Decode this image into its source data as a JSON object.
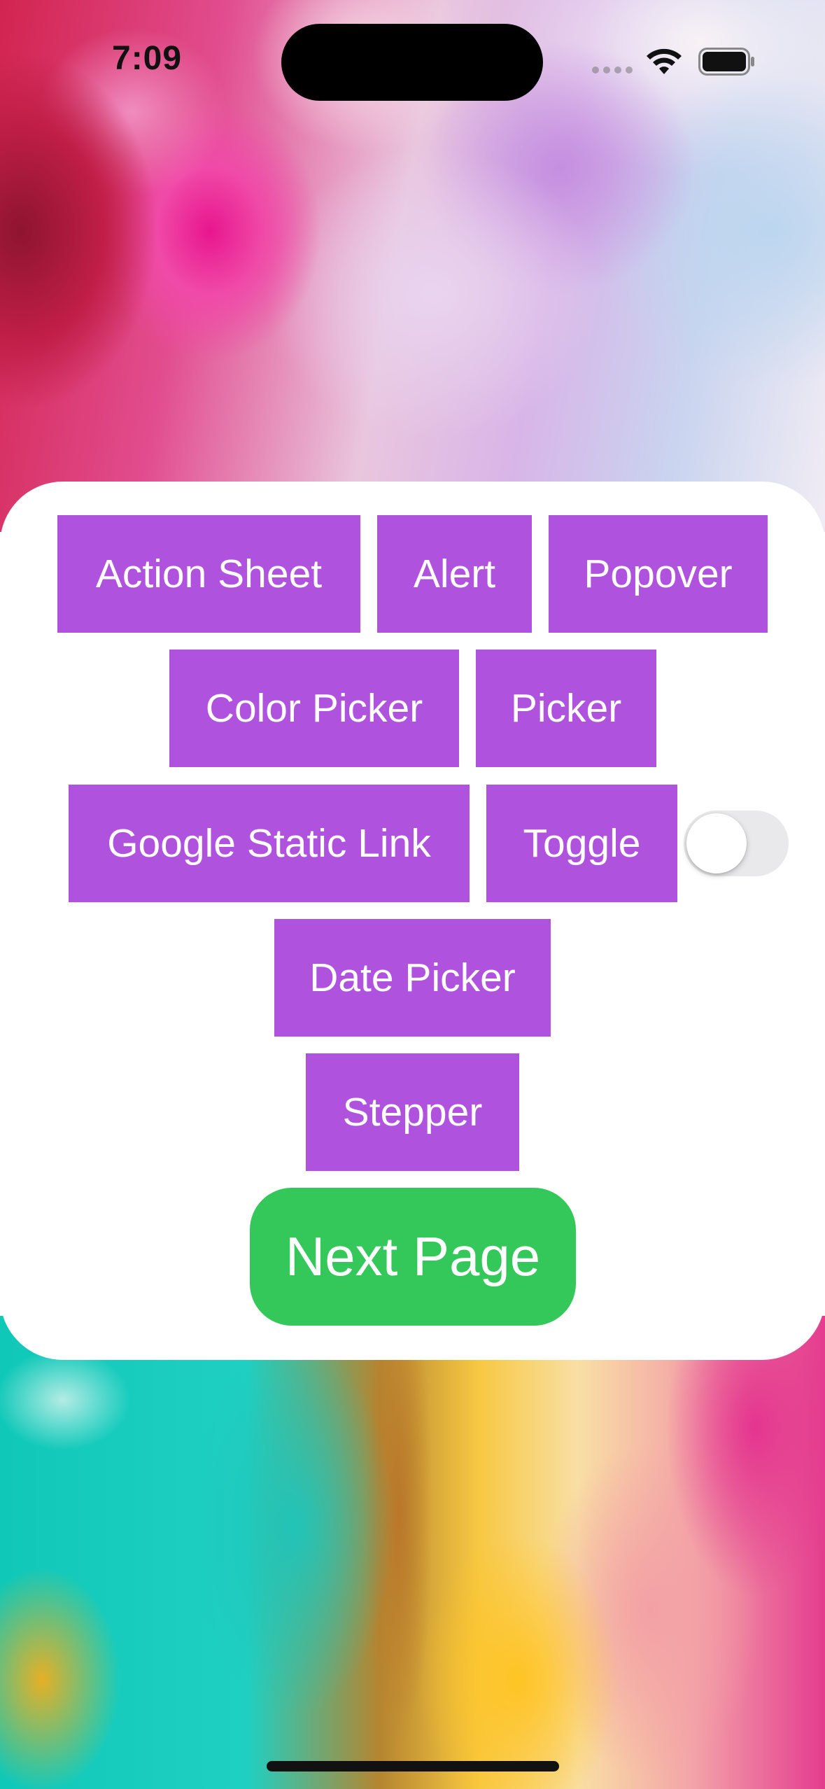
{
  "status_bar": {
    "time": "7:09",
    "icons": [
      "cellular-dots-icon",
      "wifi-icon",
      "battery-icon"
    ]
  },
  "buttons": {
    "action_sheet": "Action Sheet",
    "alert": "Alert",
    "popover": "Popover",
    "color_picker": "Color Picker",
    "picker": "Picker",
    "google_static_link": "Google Static Link",
    "toggle": "Toggle",
    "date_picker": "Date Picker",
    "stepper": "Stepper",
    "next_page": "Next Page"
  },
  "toggle_switch": {
    "is_on": false
  },
  "colors": {
    "button_purple": "#af52de",
    "button_green": "#34c759",
    "card_background": "#ffffff",
    "toggle_off_track": "#e9e9eb"
  }
}
